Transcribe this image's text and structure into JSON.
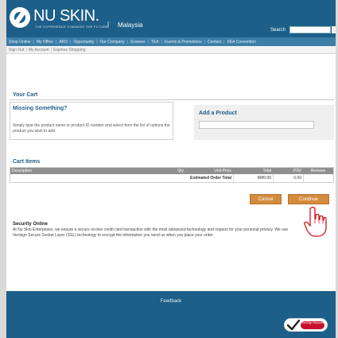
{
  "header": {
    "brand": "NU SKIN.",
    "tagline": "THE EXPERIENCE CHANGES THE FUTURE",
    "separator": "|",
    "country": "Malaysia",
    "search_label": "Search",
    "search_value": ""
  },
  "nav": {
    "items": [
      "Shop Online",
      "My Office",
      "ARO",
      "Opportunity",
      "Our Company",
      "Scanner",
      "TEA",
      "Events & Promotions",
      "Contact",
      "SEA Convention"
    ]
  },
  "subnav": {
    "items": [
      "Sign Out",
      "My Account",
      "Express Shopping"
    ]
  },
  "cart": {
    "title": "Your Cart",
    "missing": {
      "title": "Missing Something?",
      "text": "Simply type the product name or product ID number and select from the list of options the product you wish to add."
    },
    "add_product": {
      "title": "Add a Product",
      "value": ""
    },
    "items_title": "Cart Items",
    "columns": [
      "Description",
      "Qty",
      "Unit Price",
      "Total",
      "PSV",
      "Remove"
    ],
    "totals_row": {
      "label": "Estimated Order Total",
      "total": "RM0.00",
      "psv": "0.00"
    }
  },
  "buttons": {
    "cancel": "Cancel",
    "continue": "Continue"
  },
  "security": {
    "title": "Security Online",
    "text": "At Nu Skin Enterprises, we ensure a secure on-line credit card transaction with the most advanced technology and respect for your personal privacy. We use Verisign Secure Socket Layer (SSL) technology to encrypt the information you send us when you place your order."
  },
  "footer": {
    "feedback": "Feedback",
    "badge_text": "VeriSign Secured"
  },
  "colors": {
    "header_blue": "#1d5f88",
    "nav_blue": "#3d7ea8",
    "title_blue": "#205f8a",
    "button_orange": "#d38b3d",
    "hand_red": "#d4141b"
  },
  "icons": [
    "nu-skin-logo-icon",
    "pointer-hand-icon",
    "verisign-check-icon"
  ]
}
